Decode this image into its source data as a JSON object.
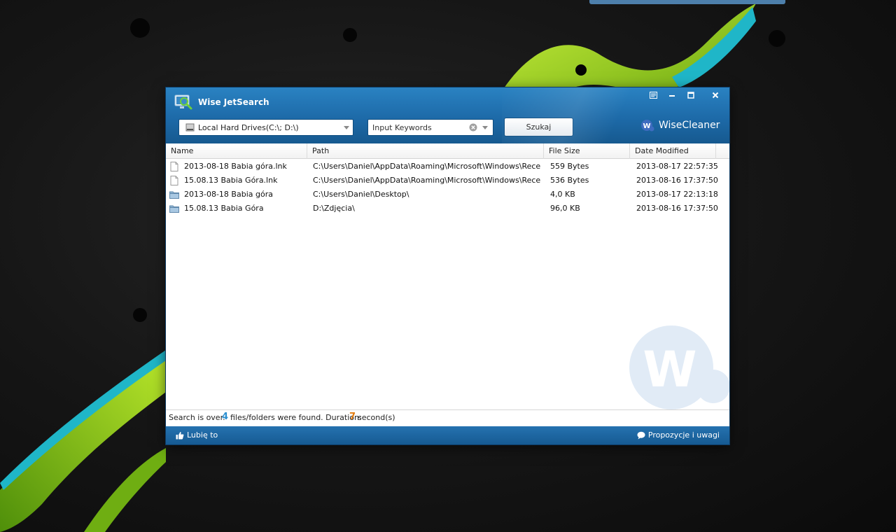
{
  "window": {
    "title": "Wise JetSearch",
    "brand": "WiseCleaner"
  },
  "toolbar": {
    "drive_value": "Local Hard Drives(C:\\; D:\\)",
    "keyword_placeholder": "Input Keywords",
    "search_label": "Szukaj"
  },
  "columns": {
    "name": "Name",
    "path": "Path",
    "size": "File Size",
    "modified": "Date Modified"
  },
  "rows": [
    {
      "type": "file",
      "name": "2013-08-18 Babia góra.lnk",
      "path": "C:\\Users\\Daniel\\AppData\\Roaming\\Microsoft\\Windows\\Recent\\",
      "size": "559 Bytes",
      "modified": "2013-08-17 22:57:35"
    },
    {
      "type": "file",
      "name": "15.08.13 Babia Góra.lnk",
      "path": "C:\\Users\\Daniel\\AppData\\Roaming\\Microsoft\\Windows\\Recent\\",
      "size": "536 Bytes",
      "modified": "2013-08-16 17:37:50"
    },
    {
      "type": "folder",
      "name": "2013-08-18 Babia góra",
      "path": "C:\\Users\\Daniel\\Desktop\\",
      "size": "4,0 KB",
      "modified": "2013-08-17 22:13:18"
    },
    {
      "type": "folder",
      "name": "15.08.13 Babia Góra",
      "path": "D:\\Zdjęcia\\",
      "size": "96,0 KB",
      "modified": "2013-08-16 17:37:50"
    }
  ],
  "status": {
    "prefix": "Search is over.",
    "count": "4",
    "middle": "files/folders were found. Duration:",
    "duration": "7",
    "suffix": "second(s)"
  },
  "footer": {
    "like": "Lubię to",
    "feedback": "Propozycje i uwagi"
  },
  "colors": {
    "titlebar": "#1d6aa8",
    "count": "#2a8ed0",
    "duration": "#e27b0e",
    "accent_green": "#9acd1e"
  }
}
